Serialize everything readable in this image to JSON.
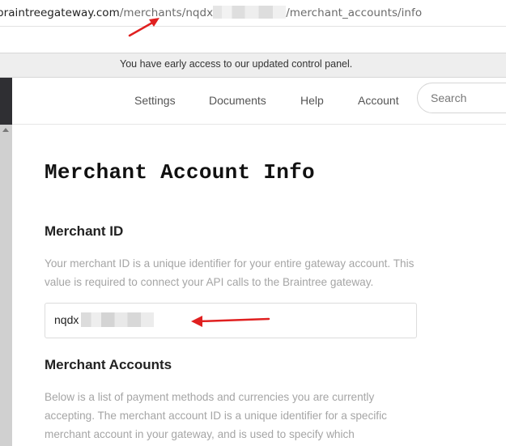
{
  "browser": {
    "url_host": "braintreegateway.com",
    "url_path_prefix": "/merchants/",
    "url_merchant_visible": "nqdx",
    "url_path_suffix": "/merchant_accounts/info"
  },
  "banner": {
    "text": "You have early access to our updated control panel."
  },
  "nav": {
    "items": [
      {
        "label": "Settings"
      },
      {
        "label": "Documents"
      },
      {
        "label": "Help"
      },
      {
        "label": "Account"
      }
    ],
    "search_placeholder": "Search"
  },
  "page": {
    "title": "Merchant Account Info",
    "merchant_id": {
      "heading": "Merchant ID",
      "description": "Your merchant ID is a unique identifier for your entire gateway account. This value is required to connect your API calls to the Braintree gateway.",
      "value_visible": "nqdx"
    },
    "merchant_accounts": {
      "heading": "Merchant Accounts",
      "description": "Below is a list of payment methods and currencies you are currently accepting. The merchant account ID is a unique identifier for a specific merchant account in your gateway, and is used to specify which"
    }
  },
  "colors": {
    "annotation_arrow": "#e02020",
    "banner_bg": "#eeeeee",
    "description_text": "#a5a5a5"
  }
}
